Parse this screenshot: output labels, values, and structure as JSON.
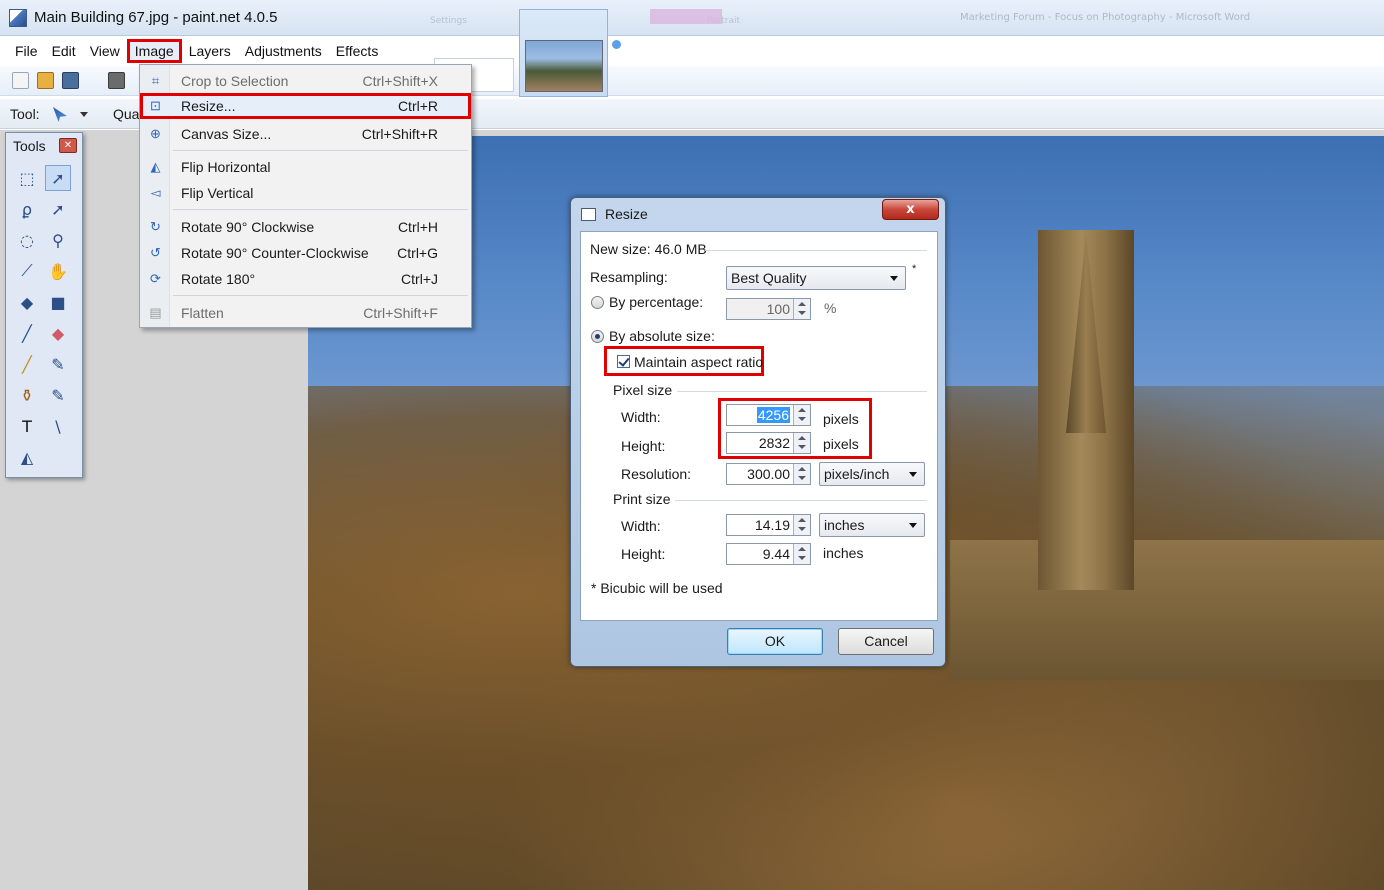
{
  "window": {
    "title": "Main Building 67.jpg - paint.net 4.0.5",
    "ghost_tabs": [
      "Settings",
      "Portrait"
    ],
    "ghost_right": "Marketing Forum - Focus on Photography - Microsoft Word"
  },
  "menubar": {
    "items": [
      "File",
      "Edit",
      "View",
      "Image",
      "Layers",
      "Adjustments",
      "Effects"
    ],
    "active": "Image"
  },
  "toolbar2": {
    "tool_label": "Tool:",
    "quality_label": "Qua"
  },
  "tools_panel": {
    "title": "Tools",
    "tools": [
      "rectangle-select-icon",
      "move-selection-icon",
      "lasso-select-icon",
      "move-selected-icon",
      "ellipse-select-icon",
      "zoom-icon",
      "magic-wand-icon",
      "pan-icon",
      "paint-bucket-icon",
      "gradient-icon",
      "paintbrush-icon",
      "eraser-icon",
      "pencil-icon",
      "color-picker-icon",
      "clone-stamp-icon",
      "recolor-icon",
      "text-icon",
      "line-curve-icon",
      "shapes-icon"
    ]
  },
  "image_menu": {
    "items": [
      {
        "label": "Crop to Selection",
        "shortcut": "Ctrl+Shift+X",
        "icon": "crop-icon",
        "disabled": true
      },
      {
        "label": "Resize...",
        "shortcut": "Ctrl+R",
        "icon": "resize-icon",
        "highlight": true
      },
      {
        "label": "Canvas Size...",
        "shortcut": "Ctrl+Shift+R",
        "icon": "canvas-size-icon"
      },
      {
        "label": "Flip Horizontal",
        "shortcut": "",
        "icon": "flip-horizontal-icon"
      },
      {
        "label": "Flip Vertical",
        "shortcut": "",
        "icon": "flip-vertical-icon"
      },
      {
        "label": "Rotate 90° Clockwise",
        "shortcut": "Ctrl+H",
        "icon": "rotate-cw-icon"
      },
      {
        "label": "Rotate 90° Counter-Clockwise",
        "shortcut": "Ctrl+G",
        "icon": "rotate-ccw-icon"
      },
      {
        "label": "Rotate 180°",
        "shortcut": "Ctrl+J",
        "icon": "rotate-180-icon"
      },
      {
        "label": "Flatten",
        "shortcut": "Ctrl+Shift+F",
        "icon": "flatten-icon",
        "disabled": true
      }
    ]
  },
  "resize_dialog": {
    "title": "Resize",
    "close_label": "x",
    "new_size": "New size: 46.0 MB",
    "resampling_label": "Resampling:",
    "resampling_value": "Best Quality",
    "resampling_note": "*",
    "by_percentage_label": "By percentage:",
    "percentage_value": "100",
    "percent_unit": "%",
    "by_absolute_label": "By absolute size:",
    "maintain_aspect_label": "Maintain aspect ratio",
    "pixel_size_label": "Pixel size",
    "width_label": "Width:",
    "height_label": "Height:",
    "pixel_width": "4256",
    "pixel_height": "2832",
    "pixels_unit": "pixels",
    "resolution_label": "Resolution:",
    "resolution_value": "300.00",
    "resolution_unit": "pixels/inch",
    "print_size_label": "Print size",
    "print_width": "14.19",
    "print_height": "9.44",
    "inches_unit": "inches",
    "footnote": "* Bicubic will be used",
    "ok_label": "OK",
    "cancel_label": "Cancel"
  },
  "colors": {
    "highlight_red": "#e00000",
    "selection_blue": "#3399ff"
  }
}
